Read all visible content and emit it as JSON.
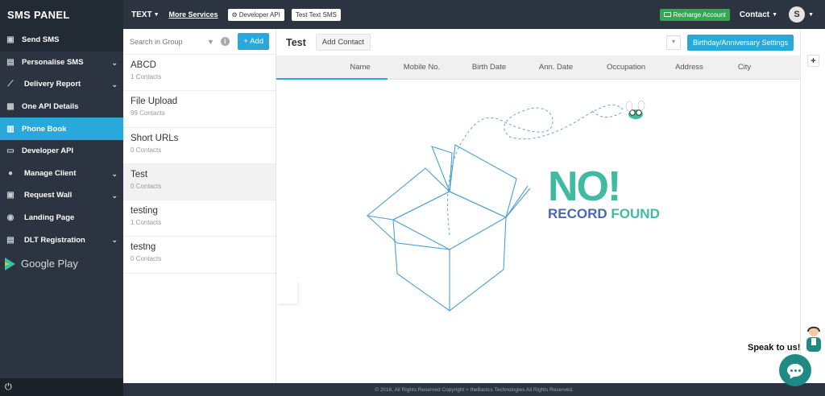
{
  "app": {
    "brand": "SMS PANEL"
  },
  "topbar": {
    "text_menu": "TEXT",
    "more_services": "More Services",
    "developer_api": "Developer API",
    "test_text_sms": "Test Text SMS",
    "recharge": "Recharge Account",
    "contact": "Contact",
    "avatar_initial": "S"
  },
  "sidebar": {
    "items": [
      {
        "label": "Send SMS",
        "icon": "send-icon"
      },
      {
        "label": "Personalise SMS",
        "icon": "personalise-icon"
      },
      {
        "label": "Delivery Report",
        "icon": "chart-icon"
      },
      {
        "label": "One API Details",
        "icon": "api-icon"
      },
      {
        "label": "Phone Book",
        "icon": "phonebook-icon"
      },
      {
        "label": "Developer API",
        "icon": "monitor-icon"
      },
      {
        "label": "Manage Client",
        "icon": "users-icon"
      },
      {
        "label": "Request Wall",
        "icon": "wall-icon"
      },
      {
        "label": "Landing Page",
        "icon": "globe-icon"
      },
      {
        "label": "DLT Registration",
        "icon": "dlt-icon"
      }
    ],
    "google_play": "Google Play"
  },
  "groups": {
    "search_placeholder": "Search in Group",
    "add_label": "+ Add",
    "items": [
      {
        "name": "ABCD",
        "count": "1 Contacts"
      },
      {
        "name": "File Upload",
        "count": "99 Contacts"
      },
      {
        "name": "Short URLs",
        "count": "0 Contacts"
      },
      {
        "name": "Test",
        "count": "0 Contacts"
      },
      {
        "name": "testing",
        "count": "1 Contacts"
      },
      {
        "name": "testng",
        "count": "0 Contacts"
      }
    ]
  },
  "main": {
    "title": "Test",
    "add_contact": "Add Contact",
    "birthday_settings": "Birthday/Anniversary Settings",
    "columns": [
      "Name",
      "Mobile No.",
      "Birth Date",
      "Ann. Date",
      "Occupation",
      "Address",
      "City"
    ],
    "empty_big": "NO!",
    "empty_record": "RECORD",
    "empty_found": "FOUND"
  },
  "footer": {
    "text": "© 2016, All Rights Reserved Copyright > theBasics Technologies All Rights Reserved."
  },
  "chat": {
    "speak": "Speak to us!"
  },
  "colors": {
    "accent": "#29a8dc",
    "sidebar": "#2b3440",
    "recharge": "#33a852",
    "no_record_green": "#3fbba2",
    "no_record_blue": "#4a68b0"
  }
}
